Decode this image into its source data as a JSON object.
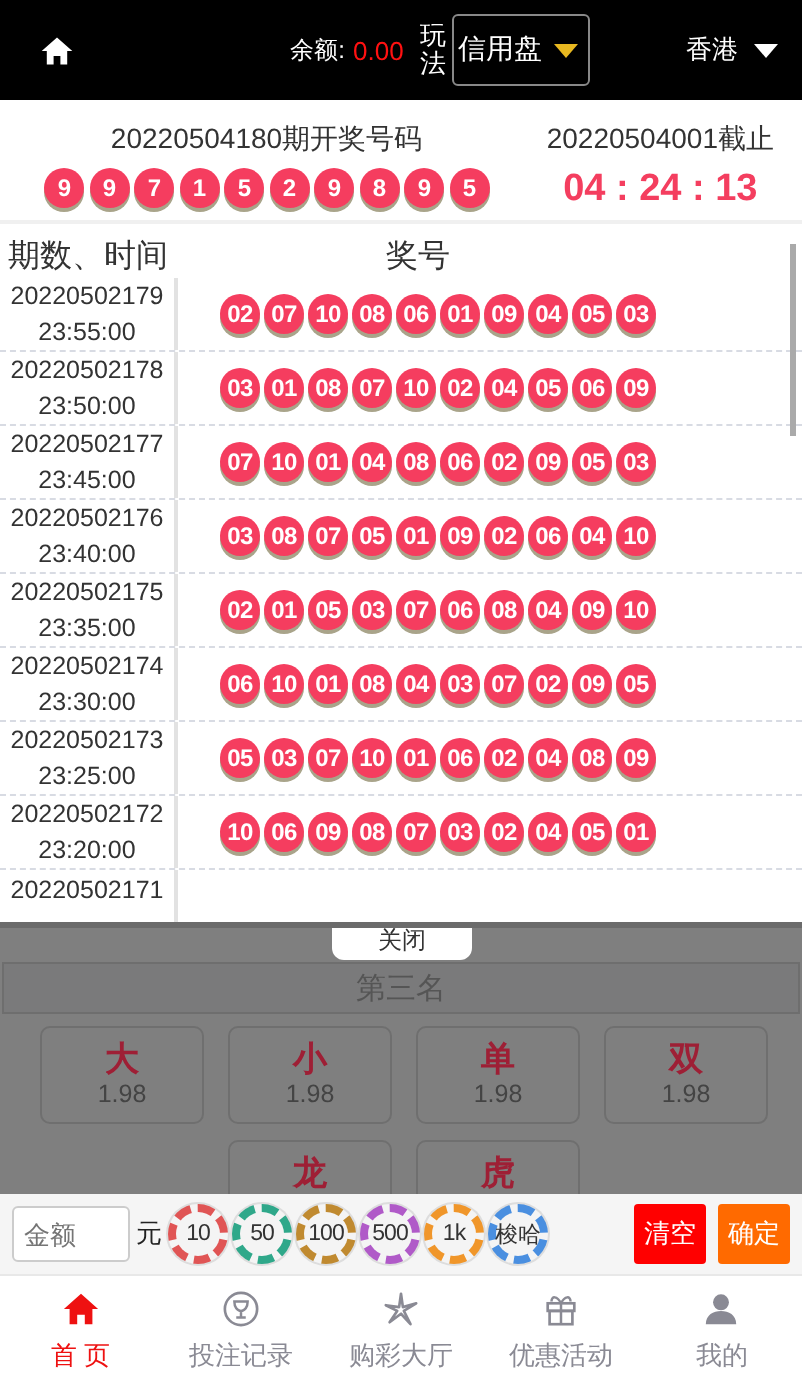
{
  "header": {
    "balance_label": "余额:",
    "balance": "0.00",
    "mode_label": "玩法",
    "mode": "信用盘",
    "region": "香港"
  },
  "draw": {
    "title": "20220504180期开奖号码",
    "numbers": [
      "9",
      "9",
      "7",
      "1",
      "5",
      "2",
      "9",
      "8",
      "9",
      "5"
    ],
    "next_label": "20220504001截止",
    "countdown": "04 : 24 : 13"
  },
  "history": {
    "columns": [
      "期数、时间",
      "奖号"
    ],
    "rows": [
      {
        "period": "20220502179",
        "time": "23:55:00",
        "balls": [
          "02",
          "07",
          "10",
          "08",
          "06",
          "01",
          "09",
          "04",
          "05",
          "03"
        ]
      },
      {
        "period": "20220502178",
        "time": "23:50:00",
        "balls": [
          "03",
          "01",
          "08",
          "07",
          "10",
          "02",
          "04",
          "05",
          "06",
          "09"
        ]
      },
      {
        "period": "20220502177",
        "time": "23:45:00",
        "balls": [
          "07",
          "10",
          "01",
          "04",
          "08",
          "06",
          "02",
          "09",
          "05",
          "03"
        ]
      },
      {
        "period": "20220502176",
        "time": "23:40:00",
        "balls": [
          "03",
          "08",
          "07",
          "05",
          "01",
          "09",
          "02",
          "06",
          "04",
          "10"
        ]
      },
      {
        "period": "20220502175",
        "time": "23:35:00",
        "balls": [
          "02",
          "01",
          "05",
          "03",
          "07",
          "06",
          "08",
          "04",
          "09",
          "10"
        ]
      },
      {
        "period": "20220502174",
        "time": "23:30:00",
        "balls": [
          "06",
          "10",
          "01",
          "08",
          "04",
          "03",
          "07",
          "02",
          "09",
          "05"
        ]
      },
      {
        "period": "20220502173",
        "time": "23:25:00",
        "balls": [
          "05",
          "03",
          "07",
          "10",
          "01",
          "06",
          "02",
          "04",
          "08",
          "09"
        ]
      },
      {
        "period": "20220502172",
        "time": "23:20:00",
        "balls": [
          "10",
          "06",
          "09",
          "08",
          "07",
          "03",
          "02",
          "04",
          "05",
          "01"
        ]
      },
      {
        "period": "20220502171"
      }
    ]
  },
  "close_button": "关闭",
  "bet": {
    "section": "第三名",
    "options": [
      {
        "label": "大",
        "odds": "1.98"
      },
      {
        "label": "小",
        "odds": "1.98"
      },
      {
        "label": "单",
        "odds": "1.98"
      },
      {
        "label": "双",
        "odds": "1.98"
      },
      {
        "label": "龙"
      },
      {
        "label": "虎"
      }
    ]
  },
  "amount": {
    "placeholder": "金额",
    "unit": "元",
    "chips": [
      {
        "label": "10",
        "color": "#e05555"
      },
      {
        "label": "50",
        "color": "#2fa88a"
      },
      {
        "label": "100",
        "color": "#c08a30"
      },
      {
        "label": "500",
        "color": "#b05ac8"
      },
      {
        "label": "1k",
        "color": "#f0962a"
      },
      {
        "label": "梭哈",
        "color": "#4a8fe0"
      }
    ],
    "clear": "清空",
    "confirm": "确定"
  },
  "tabs": [
    {
      "label": "首 页",
      "selected": true
    },
    {
      "label": "投注记录",
      "selected": false
    },
    {
      "label": "购彩大厅",
      "selected": false
    },
    {
      "label": "优惠活动",
      "selected": false
    },
    {
      "label": "我的",
      "selected": false
    }
  ]
}
